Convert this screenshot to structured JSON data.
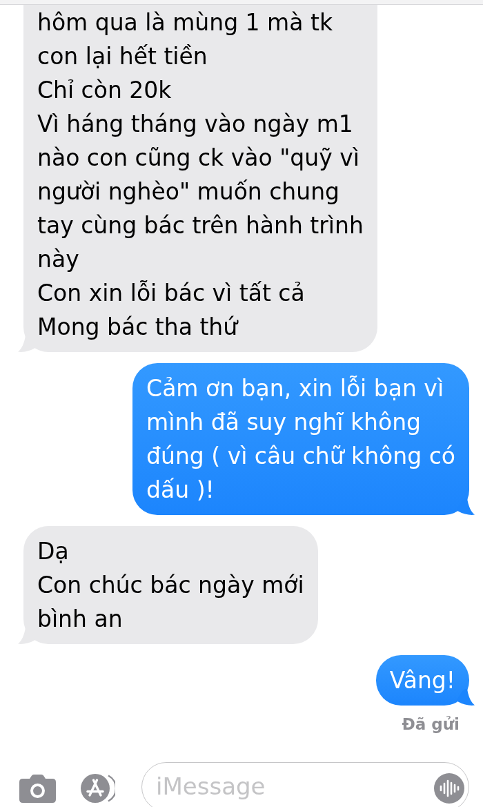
{
  "messages": [
    {
      "kind": "received",
      "text": "hôm qua là mùng 1 mà tk\ncon lại hết tiền\nChỉ còn 20k\nVì háng tháng vào ngày m1\nnào con cũng ck vào \"quỹ vì\nngười nghèo\" muốn chung\ntay cùng bác trên hành trình\nnày\nCon xin lỗi bác vì tất cả\nMong bác tha thứ"
    },
    {
      "kind": "sent",
      "text": "Cảm ơn bạn, xin lỗi bạn vì\nmình đã suy nghĩ không\nđúng ( vì câu chữ không có\ndấu )!"
    },
    {
      "kind": "received",
      "text": "Dạ\nCon chúc bác ngày mới\nbình an"
    },
    {
      "kind": "sent",
      "text": "Vâng!"
    }
  ],
  "delivery_status": "Đã gửi",
  "compose": {
    "placeholder": "iMessage"
  }
}
